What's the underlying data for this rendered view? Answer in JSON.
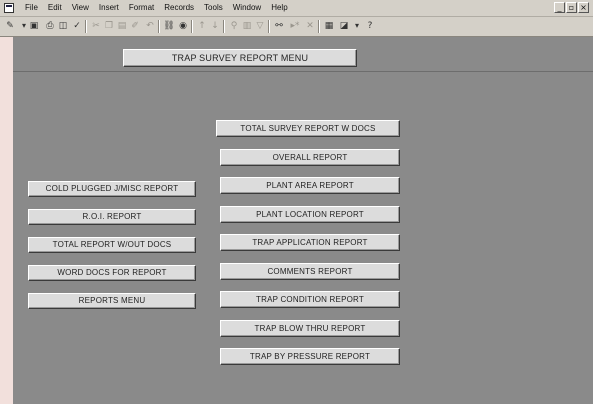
{
  "menubar": {
    "items": [
      "File",
      "Edit",
      "View",
      "Insert",
      "Format",
      "Records",
      "Tools",
      "Window",
      "Help"
    ],
    "window_controls": [
      "_",
      "▫",
      "×"
    ]
  },
  "toolbar": {
    "icons": [
      "design-view-icon",
      "save-icon",
      "print-icon",
      "print-preview-icon",
      "spelling-icon",
      "cut-icon",
      "copy-icon",
      "paste-icon",
      "format-painter-icon",
      "undo-icon",
      "insert-hyperlink-icon",
      "web-toolbar-icon",
      "sort-ascending-icon",
      "sort-descending-icon",
      "filter-by-selection-icon",
      "filter-by-form-icon",
      "apply-filter-icon",
      "find-icon",
      "new-record-icon",
      "delete-record-icon",
      "database-window-icon",
      "new-object-icon",
      "office-assistant-icon"
    ]
  },
  "form": {
    "title": "TRAP SURVEY REPORT MENU",
    "left_buttons": [
      "COLD PLUGGED J/MISC REPORT",
      "R.O.I. REPORT",
      "TOTAL REPORT W/OUT DOCS",
      "WORD DOCS FOR REPORT",
      "REPORTS MENU"
    ],
    "center_buttons": [
      "TOTAL SURVEY REPORT W DOCS",
      "OVERALL REPORT",
      "PLANT AREA REPORT",
      "PLANT LOCATION REPORT",
      "TRAP APPLICATION REPORT",
      "COMMENTS REPORT",
      "TRAP CONDITION REPORT",
      "TRAP BLOW THRU REPORT",
      "TRAP BY  PRESSURE REPORT"
    ]
  },
  "colors": {
    "form_background": "#8a8a8a",
    "button_face": "#dcdcdc",
    "chrome": "#d4d0c8",
    "page_background": "#f2e0dc"
  }
}
